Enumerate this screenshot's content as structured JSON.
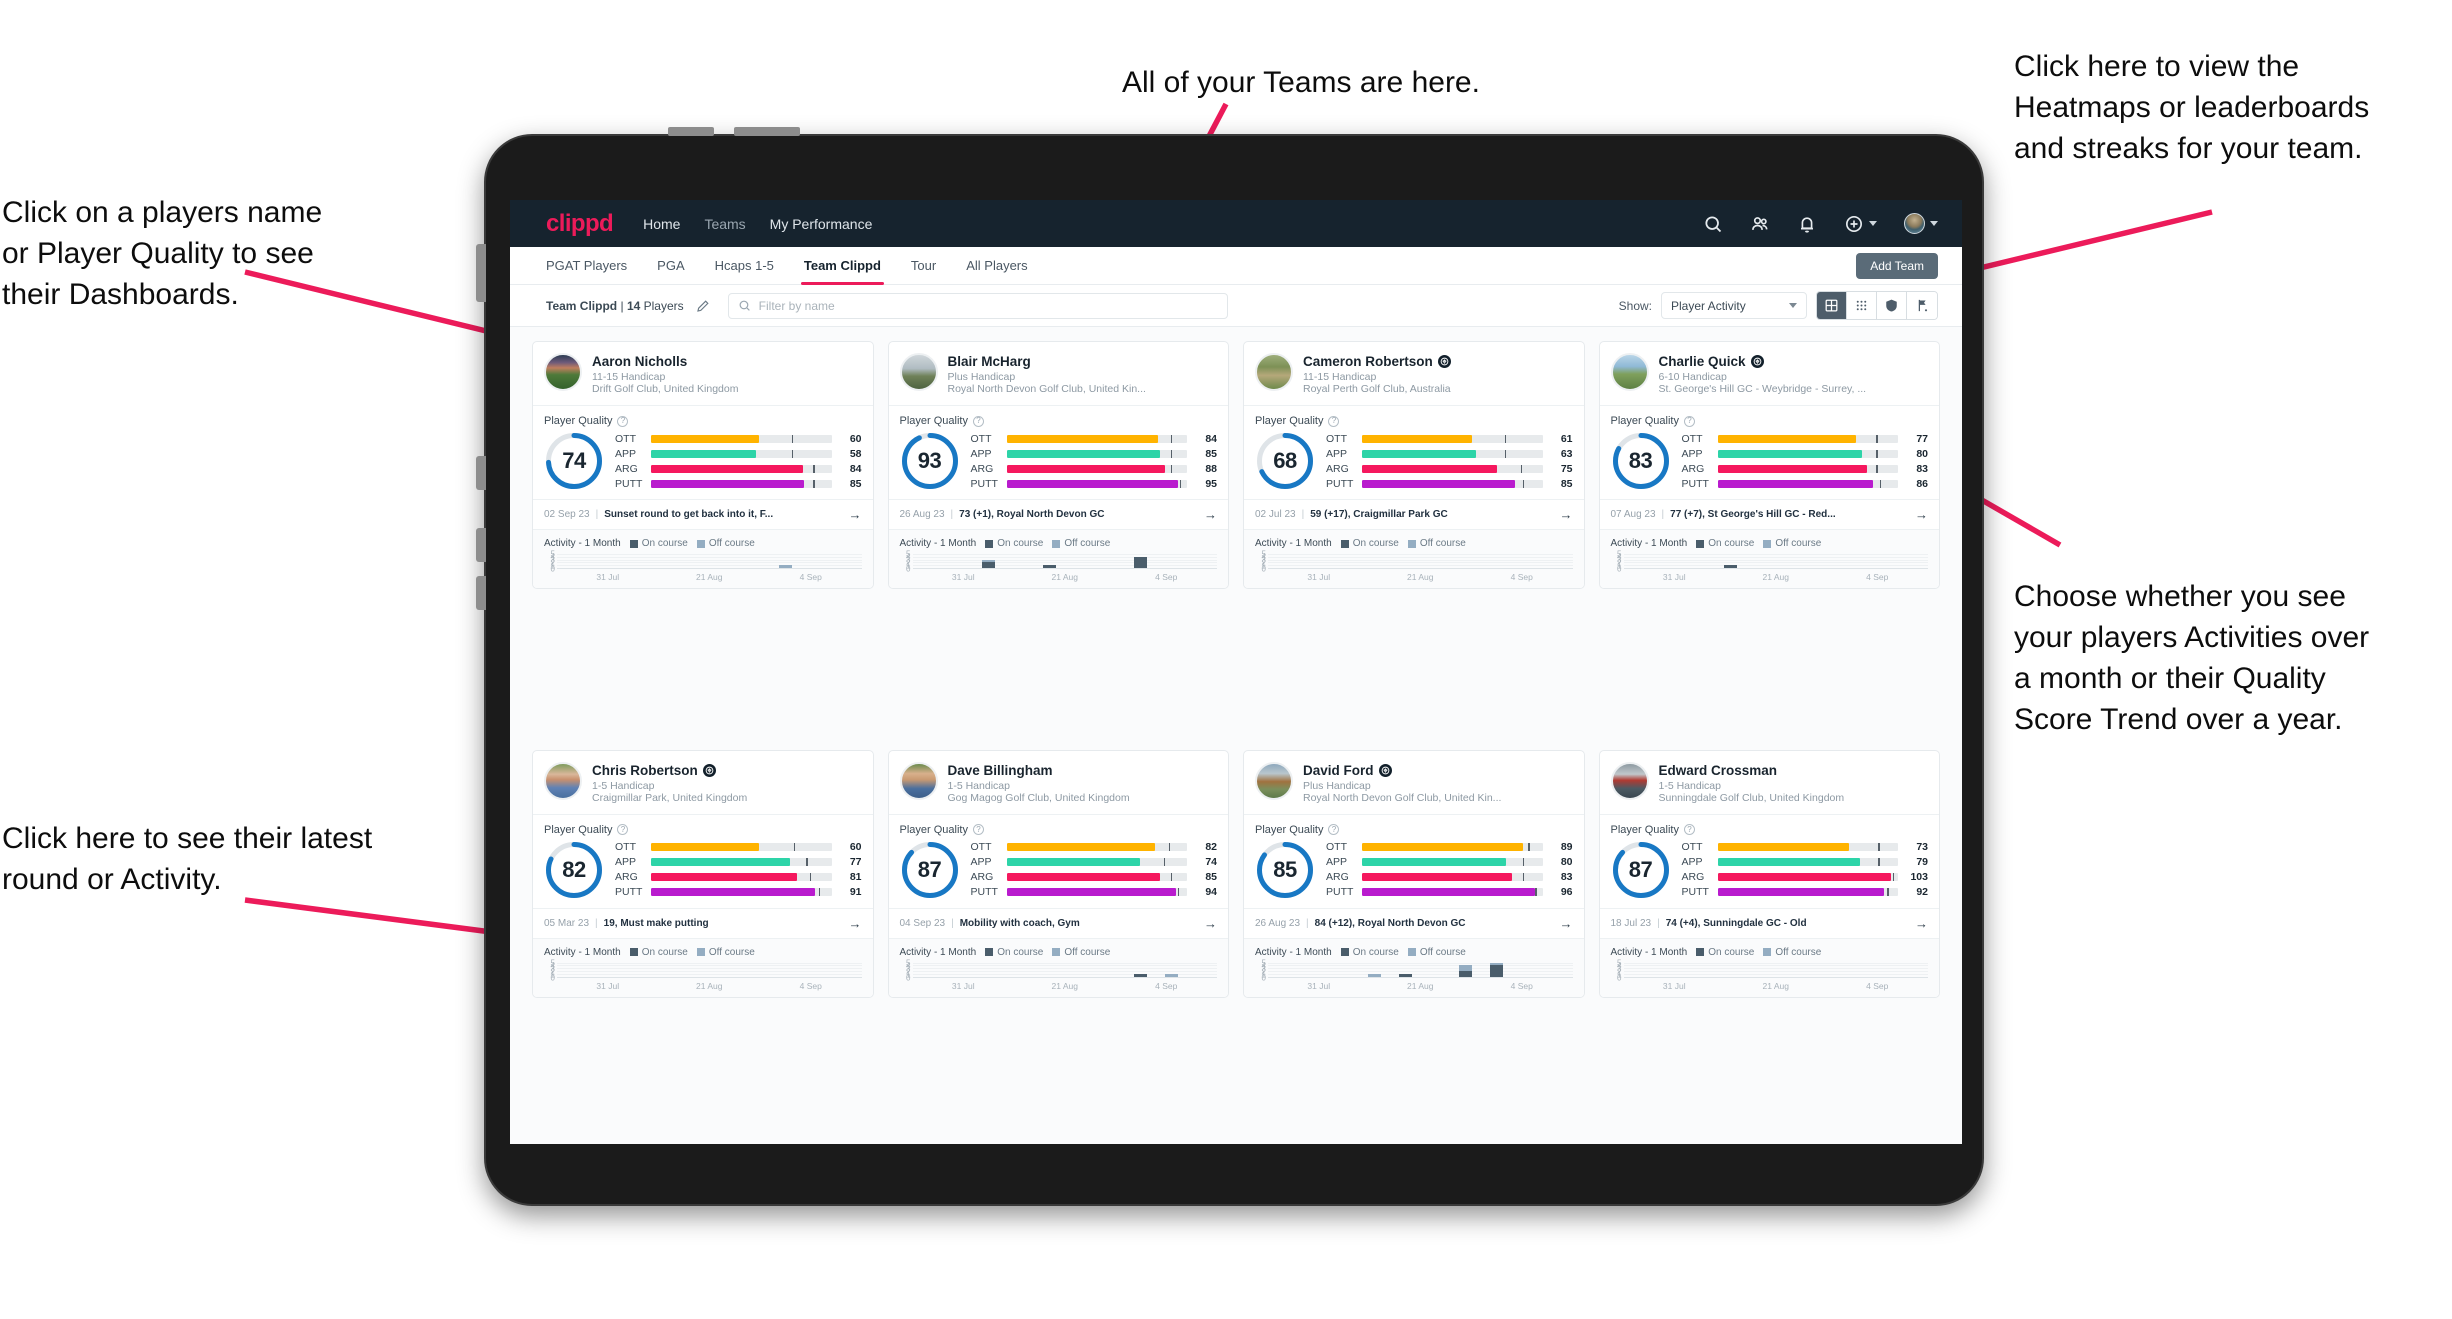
{
  "annotations": {
    "top": "All of your Teams are here.",
    "left_top": "Click on a players name\nor Player Quality to see\ntheir Dashboards.",
    "left_bottom": "Click here to see their latest\nround or Activity.",
    "right_top": "Click here to view the\nHeatmaps or leaderboards\nand streaks for your team.",
    "right_bottom": "Choose whether you see\nyour players Activities over\na month or their Quality\nScore Trend over a year."
  },
  "topnav": {
    "brand": "clippd",
    "links": [
      {
        "label": "Home",
        "active": true
      },
      {
        "label": "Teams",
        "active": false
      },
      {
        "label": "My Performance",
        "active": true
      }
    ],
    "icons": [
      "search-icon",
      "people-icon",
      "bell-icon",
      "plus-circle-icon",
      "avatar"
    ]
  },
  "tabs": {
    "items": [
      {
        "label": "PGAT Players",
        "active": false
      },
      {
        "label": "PGA",
        "active": false
      },
      {
        "label": "Hcaps 1-5",
        "active": false
      },
      {
        "label": "Team Clippd",
        "active": true
      },
      {
        "label": "Tour",
        "active": false
      },
      {
        "label": "All Players",
        "active": false
      }
    ],
    "add_team_label": "Add Team"
  },
  "toolbar": {
    "team_name": "Team Clippd",
    "separator": "|",
    "player_count": "14",
    "players_word": "Players",
    "search_placeholder": "Filter by name",
    "show_label": "Show:",
    "show_value": "Player Activity",
    "view_modes": [
      {
        "name": "grid-view-icon",
        "active": true
      },
      {
        "name": "dots-grid-view-icon",
        "active": false
      },
      {
        "name": "heatmap-shield-icon",
        "active": false
      },
      {
        "name": "flag-leaderboard-icon",
        "active": false
      }
    ]
  },
  "card_labels": {
    "player_quality": "Player Quality",
    "activity": "Activity - 1 Month",
    "legend_on": "On course",
    "legend_off": "Off course",
    "metric_labels": [
      "OTT",
      "APP",
      "ARG",
      "PUTT"
    ],
    "y_ticks": [
      "5",
      "4",
      "3",
      "2",
      "1",
      "0"
    ],
    "x_ticks": [
      "31 Jul",
      "21 Aug",
      "4 Sep"
    ]
  },
  "colors": {
    "brand_pink": "#ec1b5a",
    "navy": "#16232e",
    "ott": "#FFB300",
    "app": "#2DD4A8",
    "arg": "#F5185E",
    "putt": "#B91BCE",
    "ring": "#1878C4",
    "on_course": "#4a5d6b",
    "off_course": "#94adc2",
    "annotation_arrow": "#ec1b5a"
  },
  "chart_data": {
    "type": "bar",
    "title": "Activity - 1 Month",
    "ylabel": "",
    "xlabel": "",
    "ylim": [
      0,
      5
    ],
    "grid": true,
    "legend": [
      "On course",
      "Off course"
    ],
    "x_tick_labels": [
      "31 Jul",
      "21 Aug",
      "4 Sep"
    ],
    "bins": 10,
    "per_player": [
      {
        "player": "Aaron Nicholls",
        "on_course": [
          0,
          0,
          0,
          0,
          0,
          0,
          0,
          0,
          0,
          0
        ],
        "off_course": [
          0,
          0,
          0,
          0,
          0,
          0,
          0,
          1,
          0,
          0
        ]
      },
      {
        "player": "Blair McHarg",
        "on_course": [
          0,
          0,
          2,
          0,
          1,
          0,
          0,
          4,
          0,
          0
        ],
        "off_course": [
          0,
          0,
          1,
          0,
          0,
          0,
          0,
          0,
          0,
          0
        ]
      },
      {
        "player": "Cameron Robertson",
        "on_course": [
          0,
          0,
          0,
          0,
          0,
          0,
          0,
          0,
          0,
          0
        ],
        "off_course": [
          0,
          0,
          0,
          0,
          0,
          0,
          0,
          0,
          0,
          0
        ]
      },
      {
        "player": "Charlie Quick",
        "on_course": [
          0,
          0,
          0,
          1,
          0,
          0,
          0,
          0,
          0,
          0
        ],
        "off_course": [
          0,
          0,
          0,
          0,
          0,
          0,
          0,
          0,
          0,
          0
        ]
      },
      {
        "player": "Chris Robertson",
        "on_course": [
          0,
          0,
          0,
          0,
          0,
          0,
          0,
          0,
          0,
          0
        ],
        "off_course": [
          0,
          0,
          0,
          0,
          0,
          0,
          0,
          0,
          0,
          0
        ]
      },
      {
        "player": "Dave Billingham",
        "on_course": [
          0,
          0,
          0,
          0,
          0,
          0,
          0,
          1,
          0,
          0
        ],
        "off_course": [
          0,
          0,
          0,
          0,
          0,
          0,
          0,
          0,
          1,
          0
        ]
      },
      {
        "player": "David Ford",
        "on_course": [
          0,
          0,
          0,
          0,
          1,
          0,
          2,
          4,
          0,
          0
        ],
        "off_course": [
          0,
          0,
          0,
          1,
          0,
          0,
          2,
          1,
          0,
          0
        ]
      },
      {
        "player": "Edward Crossman",
        "on_course": [
          0,
          0,
          0,
          0,
          0,
          0,
          0,
          0,
          0,
          0
        ],
        "off_course": [
          0,
          0,
          0,
          0,
          0,
          0,
          0,
          0,
          0,
          0
        ]
      }
    ]
  },
  "players": [
    {
      "name": "Aaron Nicholls",
      "verified": false,
      "handicap": "11-15 Handicap",
      "club": "Drift Golf Club, United Kingdom",
      "quality_score": "74",
      "metrics": [
        {
          "label": "OTT",
          "value": "60",
          "fill_pct": 60,
          "tick_pct": 78
        },
        {
          "label": "APP",
          "value": "58",
          "fill_pct": 58,
          "tick_pct": 78
        },
        {
          "label": "ARG",
          "value": "84",
          "fill_pct": 84,
          "tick_pct": 90
        },
        {
          "label": "PUTT",
          "value": "85",
          "fill_pct": 85,
          "tick_pct": 90
        }
      ],
      "latest_date": "02 Sep 23",
      "latest_text": "Sunset round to get back into it, F...",
      "avatar_css": "linear-gradient(180deg,#2c3c52 0%,#6d5a7a 22%,#c07e5e 38%,#4e7a3a 58%,#33612b 100%)"
    },
    {
      "name": "Blair McHarg",
      "verified": false,
      "handicap": "Plus Handicap",
      "club": "Royal North Devon Golf Club, United Kin...",
      "quality_score": "93",
      "metrics": [
        {
          "label": "OTT",
          "value": "84",
          "fill_pct": 84,
          "tick_pct": 91
        },
        {
          "label": "APP",
          "value": "85",
          "fill_pct": 85,
          "tick_pct": 91
        },
        {
          "label": "ARG",
          "value": "88",
          "fill_pct": 88,
          "tick_pct": 91
        },
        {
          "label": "PUTT",
          "value": "95",
          "fill_pct": 95,
          "tick_pct": 96
        }
      ],
      "latest_date": "26 Aug 23",
      "latest_text": "73 (+1), Royal North Devon GC",
      "avatar_css": "linear-gradient(180deg,#cfd6da 0%,#b0bcc2 40%,#6f8159 62%,#4d6340 100%)"
    },
    {
      "name": "Cameron Robertson",
      "verified": true,
      "handicap": "11-15 Handicap",
      "club": "Royal Perth Golf Club, Australia",
      "quality_score": "68",
      "metrics": [
        {
          "label": "OTT",
          "value": "61",
          "fill_pct": 61,
          "tick_pct": 79
        },
        {
          "label": "APP",
          "value": "63",
          "fill_pct": 63,
          "tick_pct": 79
        },
        {
          "label": "ARG",
          "value": "75",
          "fill_pct": 75,
          "tick_pct": 88
        },
        {
          "label": "PUTT",
          "value": "85",
          "fill_pct": 85,
          "tick_pct": 89
        }
      ],
      "latest_date": "02 Jul 23",
      "latest_text": "59 (+17), Craigmillar Park GC",
      "avatar_css": "linear-gradient(180deg,#9eae7b 0%,#7d9156 35%,#b5a87a 60%,#6e8a4c 100%)"
    },
    {
      "name": "Charlie Quick",
      "verified": true,
      "handicap": "6-10 Handicap",
      "club": "St. George's Hill GC - Weybridge - Surrey, ...",
      "quality_score": "83",
      "metrics": [
        {
          "label": "OTT",
          "value": "77",
          "fill_pct": 77,
          "tick_pct": 88
        },
        {
          "label": "APP",
          "value": "80",
          "fill_pct": 80,
          "tick_pct": 88
        },
        {
          "label": "ARG",
          "value": "83",
          "fill_pct": 83,
          "tick_pct": 88
        },
        {
          "label": "PUTT",
          "value": "86",
          "fill_pct": 86,
          "tick_pct": 90
        }
      ],
      "latest_date": "07 Aug 23",
      "latest_text": "77 (+7), St George's Hill GC - Red...",
      "avatar_css": "linear-gradient(180deg,#b9d5e8 0%,#8fb9d6 34%,#7fa05c 56%,#5d8044 100%)"
    },
    {
      "name": "Chris Robertson",
      "verified": true,
      "handicap": "1-5 Handicap",
      "club": "Craigmillar Park, United Kingdom",
      "quality_score": "82",
      "metrics": [
        {
          "label": "OTT",
          "value": "60",
          "fill_pct": 60,
          "tick_pct": 79
        },
        {
          "label": "APP",
          "value": "77",
          "fill_pct": 77,
          "tick_pct": 86
        },
        {
          "label": "ARG",
          "value": "81",
          "fill_pct": 81,
          "tick_pct": 88
        },
        {
          "label": "PUTT",
          "value": "91",
          "fill_pct": 91,
          "tick_pct": 93
        }
      ],
      "latest_date": "05 Mar 23",
      "latest_text": "19, Must make putting",
      "avatar_css": "linear-gradient(180deg,#7f9c5e 0%,#d9b79a 30%,#c8906e 46%,#5f82b5 70%,#4a6f9e 100%)"
    },
    {
      "name": "Dave Billingham",
      "verified": false,
      "handicap": "1-5 Handicap",
      "club": "Gog Magog Golf Club, United Kingdom",
      "quality_score": "87",
      "metrics": [
        {
          "label": "OTT",
          "value": "82",
          "fill_pct": 82,
          "tick_pct": 90
        },
        {
          "label": "APP",
          "value": "74",
          "fill_pct": 74,
          "tick_pct": 87
        },
        {
          "label": "ARG",
          "value": "85",
          "fill_pct": 85,
          "tick_pct": 91
        },
        {
          "label": "PUTT",
          "value": "94",
          "fill_pct": 94,
          "tick_pct": 95
        }
      ],
      "latest_date": "04 Sep 23",
      "latest_text": "Mobility with coach, Gym",
      "avatar_css": "linear-gradient(180deg,#6c8b4e 0%,#d8b08c 28%,#c99a72 46%,#4a6f9e 72%,#3d5f8a 100%)"
    },
    {
      "name": "David Ford",
      "verified": true,
      "handicap": "Plus Handicap",
      "club": "Royal North Devon Golf Club, United Kin...",
      "quality_score": "85",
      "metrics": [
        {
          "label": "OTT",
          "value": "89",
          "fill_pct": 89,
          "tick_pct": 92
        },
        {
          "label": "APP",
          "value": "80",
          "fill_pct": 80,
          "tick_pct": 89
        },
        {
          "label": "ARG",
          "value": "83",
          "fill_pct": 83,
          "tick_pct": 89
        },
        {
          "label": "PUTT",
          "value": "96",
          "fill_pct": 96,
          "tick_pct": 96
        }
      ],
      "latest_date": "26 Aug 23",
      "latest_text": "84 (+12), Royal North Devon GC",
      "avatar_css": "linear-gradient(180deg,#8ea9bd 0%,#b9c6cd 28%,#a0723f 52%,#7b8f5c 74%,#5d7a4a 100%)"
    },
    {
      "name": "Edward Crossman",
      "verified": false,
      "handicap": "1-5 Handicap",
      "club": "Sunningdale Golf Club, United Kingdom",
      "quality_score": "87",
      "metrics": [
        {
          "label": "OTT",
          "value": "73",
          "fill_pct": 73,
          "tick_pct": 89
        },
        {
          "label": "APP",
          "value": "79",
          "fill_pct": 79,
          "tick_pct": 89
        },
        {
          "label": "ARG",
          "value": "103",
          "fill_pct": 96,
          "tick_pct": 97
        },
        {
          "label": "PUTT",
          "value": "92",
          "fill_pct": 92,
          "tick_pct": 94
        }
      ],
      "latest_date": "18 Jul 23",
      "latest_text": "74 (+4), Sunningdale GC - Old",
      "avatar_css": "linear-gradient(180deg,#8d9aa2 0%,#c0c7cb 30%,#b03a32 48%,#4c5a63 72%,#394650 100%)"
    }
  ]
}
